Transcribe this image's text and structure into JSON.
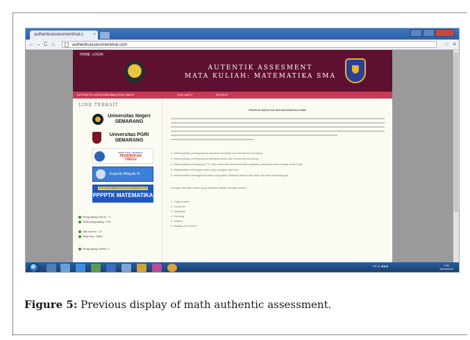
{
  "browser": {
    "tab_title": "authenticassessmentmat.c",
    "tab_close": "×",
    "url": "authenticassessmentmat.com",
    "nav_back": "←",
    "nav_forward": "→",
    "nav_reload": "C",
    "nav_home": "⌂",
    "star": "☆",
    "menu": "≡"
  },
  "site": {
    "header_links": [
      "HOME",
      "LOGIN"
    ],
    "title_line1": "AUTENTIK ASSESMENT",
    "title_line2": "MATA KULIAH: MATEMATIKA SMA",
    "menu": [
      "AUTHENTIC ASSESSMENT",
      "MATERIAL MATH",
      "QUIZ MATH",
      "SOURCE"
    ],
    "sidebar_heading": "LINK TERKAIT",
    "logos": {
      "unnes": [
        "Universitas Negeri",
        "SEMARANG"
      ],
      "upgris": [
        "Universitas PGRI",
        "SEMARANG"
      ],
      "dikti_small": "DIREKTORAT JENDERAL",
      "dikti_big": [
        "PENDIDIKAN",
        "TINGGI"
      ],
      "kopertis": "Kopertis Wilayah VI",
      "pppptk_top": "PUSAT PENGEMBANGAN DAN PEMBERDAYAAN",
      "pppptk": "PPPPTK MATEMATIKA"
    },
    "stats": [
      "Pengunjung hari ini : 4",
      "Total pengunjung : 276",
      "Hits hari ini : 12",
      "Total Hits : 5464",
      "Pengunjung Online: 1"
    ],
    "main_title": "PROFILE MATA KULIAH MATEMATIKA SMA",
    "objectives": [
      "1.  Menunjukkan pentingnya pemecahan masalah dan membuat contohnya",
      "2.  Menunjukkan pentingnya pendekatan kelas dan membuat contohnya",
      "3.  Menunjukkan pentingnya CTL dan membuat contohnya Menunjukkan prasyarat untuk belajar suatu topik",
      "4.  Menjelaskan hubungan suatu topik dengan topik lain",
      "5.  Menyebutkan berbagai kesulitan yang akan dihadapi pada suatu topik dan latar belakangnya"
    ],
    "scope_intro": "Dengan cakupan materi yang dibahas adalah sebagai berikut:",
    "topics": [
      "1.  Trigonometri",
      "2.  Geometri",
      "3.  Statistika",
      "4.  Peluang",
      "5.  Matriks",
      "6.  Barisan dan Deret"
    ]
  },
  "taskbar": {
    "tray": "EN  ▲  ◀  ■  ▶",
    "time": "7:30",
    "date": "16/06/2015"
  },
  "caption": {
    "label": "Figure 5:",
    "text": " Previous display of math authentic assessment."
  }
}
